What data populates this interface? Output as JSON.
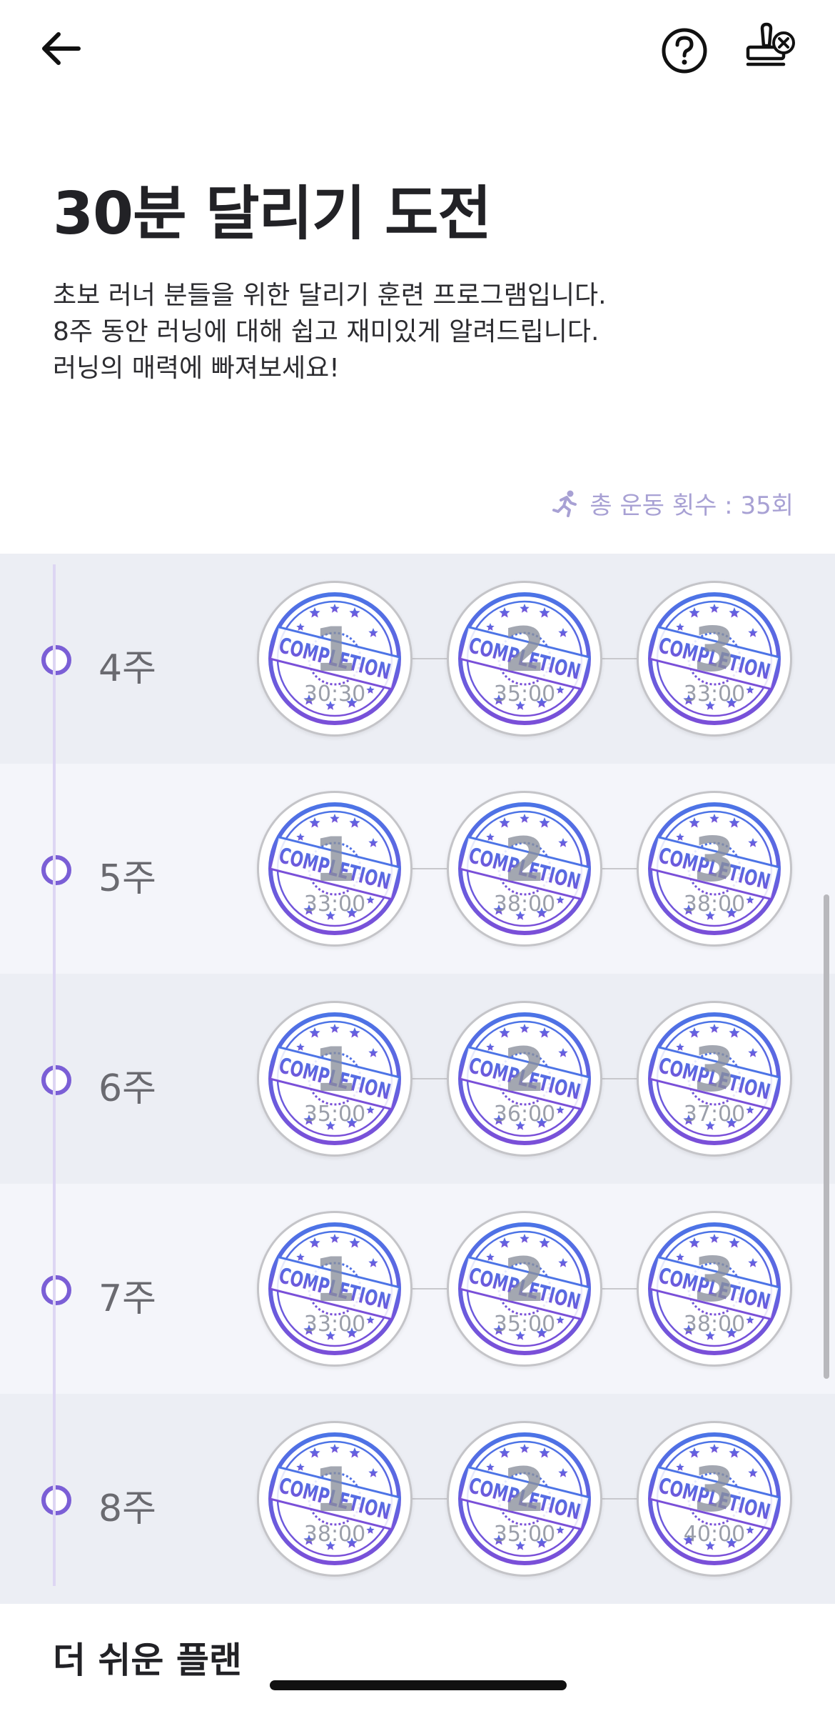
{
  "header": {
    "back_icon": "arrow-left-icon",
    "help_icon": "question-circle-icon",
    "stamp_icon": "stamp-x-icon"
  },
  "challenge": {
    "title": "30분 달리기 도전",
    "description_lines": [
      "초보 러너 분들을 위한 달리기 훈련 프로그램입니다.",
      "8주 동안 러닝에 대해 쉽고 재미있게 알려드립니다.",
      "러닝의 매력에 빠져보세요!"
    ]
  },
  "stats": {
    "icon": "running-icon",
    "total_workouts": "총 운동 횟수 : 35회"
  },
  "weeks": [
    {
      "label": "4주",
      "sessions": [
        {
          "number": "1",
          "time": "30:30"
        },
        {
          "number": "2",
          "time": "35:00"
        },
        {
          "number": "3",
          "time": "33:00"
        }
      ]
    },
    {
      "label": "5주",
      "sessions": [
        {
          "number": "1",
          "time": "33:00"
        },
        {
          "number": "2",
          "time": "38:00"
        },
        {
          "number": "3",
          "time": "38:00"
        }
      ]
    },
    {
      "label": "6주",
      "sessions": [
        {
          "number": "1",
          "time": "35:00"
        },
        {
          "number": "2",
          "time": "36:00"
        },
        {
          "number": "3",
          "time": "37:00"
        }
      ]
    },
    {
      "label": "7주",
      "sessions": [
        {
          "number": "1",
          "time": "33:00"
        },
        {
          "number": "2",
          "time": "35:00"
        },
        {
          "number": "3",
          "time": "38:00"
        }
      ]
    },
    {
      "label": "8주",
      "sessions": [
        {
          "number": "1",
          "time": "38:00"
        },
        {
          "number": "2",
          "time": "35:00"
        },
        {
          "number": "3",
          "time": "40:00"
        }
      ]
    }
  ],
  "stamp_text": "COMPLETION",
  "colors": {
    "accent": "#7b5fd6",
    "stamp_blue": "#4c74e6",
    "stamp_purple": "#7a4fd8",
    "row_shade": "#eceef4"
  },
  "easier_plan": {
    "heading": "더 쉬운 플랜"
  }
}
